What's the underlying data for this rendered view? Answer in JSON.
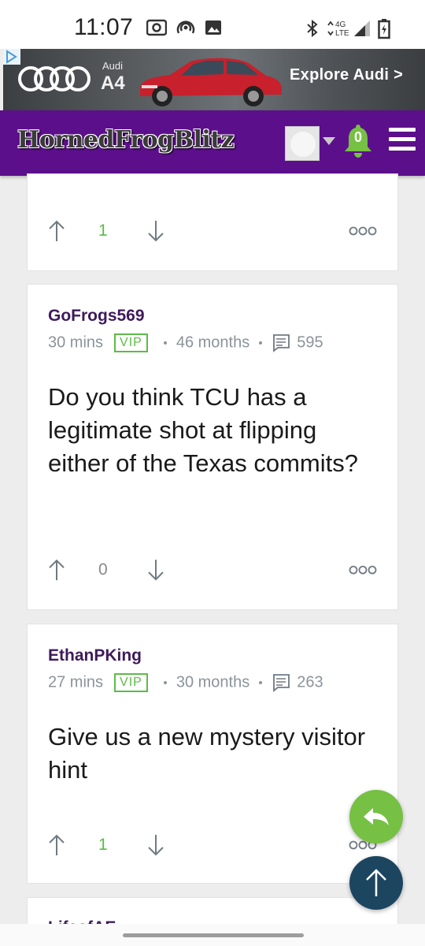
{
  "status_bar": {
    "time": "11:07",
    "left_icons": [
      "radio-icon",
      "podcast-icon",
      "gallery-icon"
    ],
    "right_icons": [
      "bluetooth-icon",
      "network-4g-lte-icon",
      "signal-icon",
      "battery-charging-icon"
    ],
    "network_label_top": "4G",
    "network_label_bottom": "LTE"
  },
  "ad": {
    "brand": "Audi",
    "model": "A4",
    "cta": "Explore Audi >",
    "car_color": "#c8202c"
  },
  "site_header": {
    "logo": "HornedFrogBlitz",
    "notification_count": "0",
    "brand_color": "#5c0f8b",
    "accent_green": "#5dbb46"
  },
  "posts": [
    {
      "upvotes": "1"
    },
    {
      "username": "GoFrogs569",
      "time": "30 mins",
      "badge": "VIP",
      "membership": "46 months",
      "post_count": "595",
      "text": "Do you think TCU has a legitimate shot at flipping either of the Texas commits?",
      "upvotes": "0"
    },
    {
      "username": "EthanPKing",
      "time": "27 mins",
      "badge": "VIP",
      "membership": "30 months",
      "post_count": "263",
      "text": "Give us a new mystery visitor hint",
      "upvotes": "1"
    },
    {
      "username": "LifeofAE"
    }
  ]
}
